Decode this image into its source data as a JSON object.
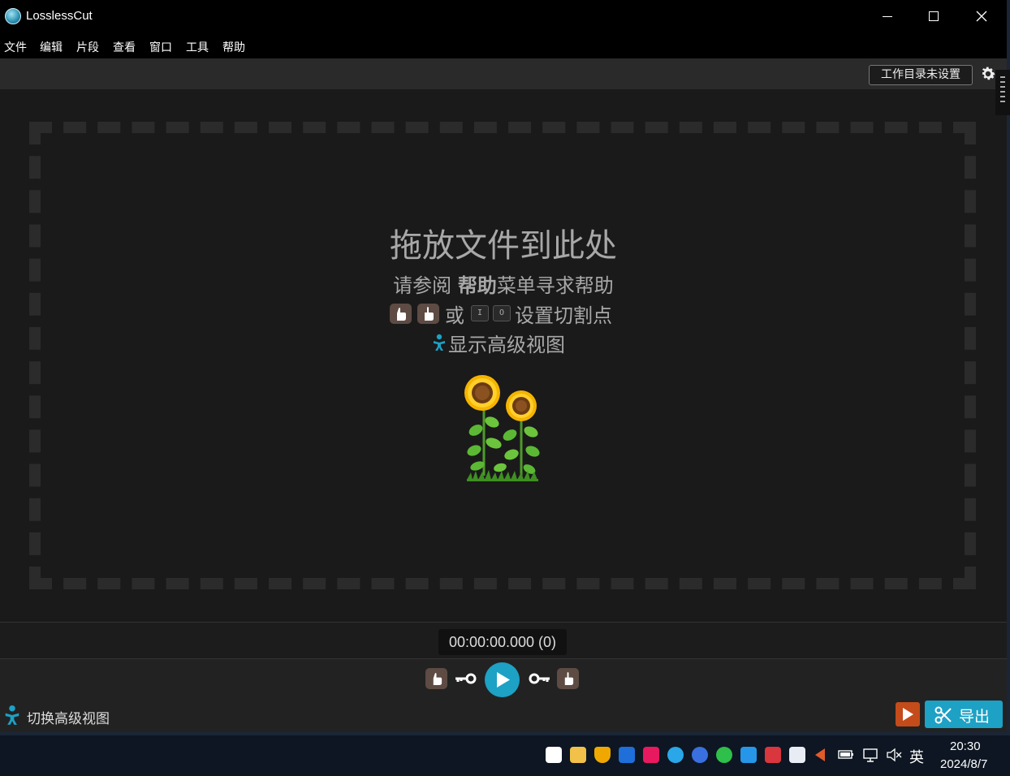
{
  "window": {
    "title": "LosslessCut"
  },
  "menu": {
    "items": [
      "文件",
      "编辑",
      "片段",
      "查看",
      "窗口",
      "工具",
      "帮助"
    ]
  },
  "topbar": {
    "workdir_label": "工作目录未设置"
  },
  "drop_zone": {
    "title": "拖放文件到此处",
    "help_prefix": "请参阅 ",
    "help_bold": "帮助",
    "help_suffix": "菜单寻求帮助",
    "or_text": "或",
    "key_in": "I",
    "key_out": "O",
    "cut_text": "设置切割点",
    "advanced_text": "显示高级视图"
  },
  "timeline": {
    "timecode": "00:00:00.000 (0)"
  },
  "bottombar": {
    "toggle_advanced_label": "切换高级视图",
    "export_label": "导出"
  },
  "taskbar": {
    "ime": "英",
    "time": "20:30",
    "date": "2024/8/7"
  },
  "colors": {
    "accent": "#1da1c5",
    "background": "#1a1a1a",
    "format_button": "#c44b1a"
  }
}
